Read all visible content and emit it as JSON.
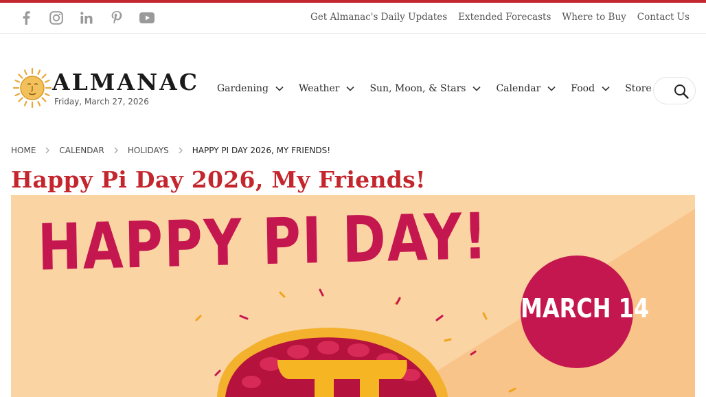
{
  "social": [
    {
      "name": "facebook-icon"
    },
    {
      "name": "instagram-icon"
    },
    {
      "name": "linkedin-icon"
    },
    {
      "name": "pinterest-icon"
    },
    {
      "name": "youtube-icon"
    }
  ],
  "utility_links": [
    "Get Almanac's Daily Updates",
    "Extended Forecasts",
    "Where to Buy",
    "Contact Us"
  ],
  "logo": {
    "wordmark": "ALMANAC",
    "date": "Friday, March 27, 2026"
  },
  "nav": [
    "Gardening",
    "Weather",
    "Sun, Moon, & Stars",
    "Calendar",
    "Food",
    "Store"
  ],
  "breadcrumb": [
    "HOME",
    "CALENDAR",
    "HOLIDAYS",
    "HAPPY PI DAY 2026, MY FRIENDS!"
  ],
  "page_title": "Happy Pi Day 2026, My Friends!",
  "hero": {
    "headline": "HAPPY PI DAY!",
    "badge": "MARCH 14"
  },
  "colors": {
    "brand_red": "#c4262e",
    "hero_bg": "#fbd4a3",
    "hero_pink": "#c5174f"
  }
}
